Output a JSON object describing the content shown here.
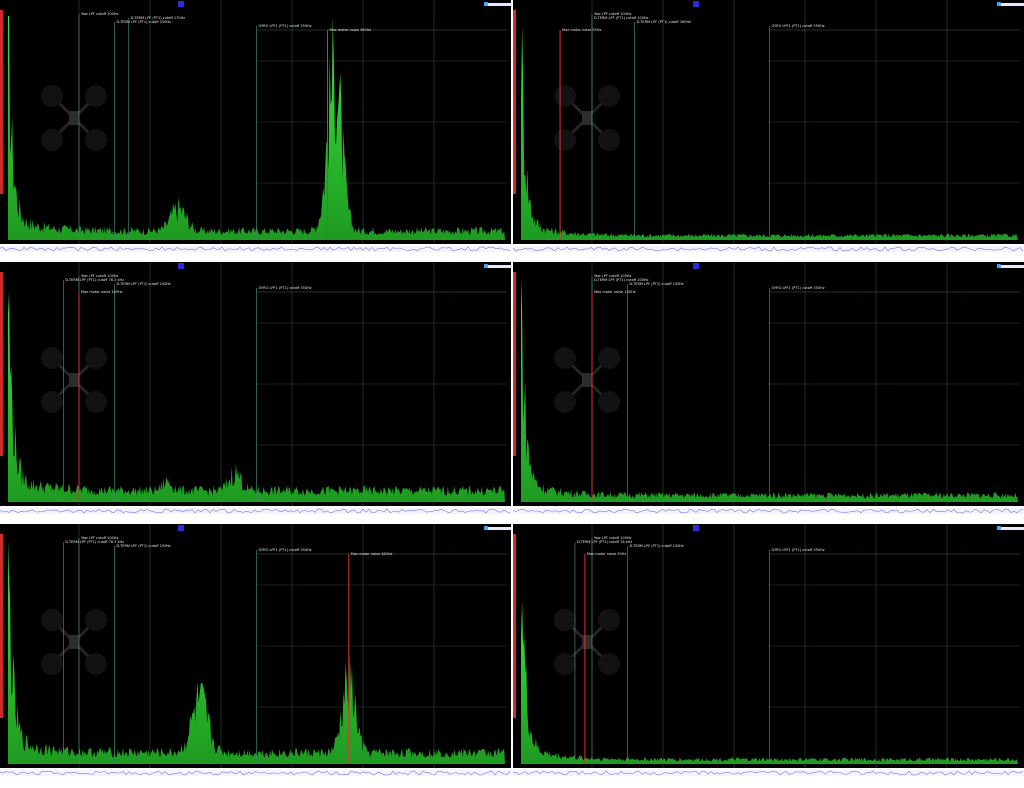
{
  "panels": [
    {
      "id": "p1",
      "title": "",
      "lines": [
        {
          "label": "Yaw LPF cutoff 100Hz",
          "hz": 100
        },
        {
          "label": "D-TERM LPF (PT1) cutoff 170Hz",
          "hz": 170
        },
        {
          "label": "D-TERM LPF (PT1) cutoff 150Hz",
          "hz": 150
        },
        {
          "label": "GYRO LPF1 (PT1) cutoff 350Hz",
          "hz": 350
        },
        {
          "label": "Max motor noise 450Hz",
          "hz": 450
        }
      ],
      "spectrum": {
        "base": 4,
        "peaks": [
          {
            "hz": 240,
            "amp": 10,
            "w": 15
          },
          {
            "hz": 460,
            "amp": 70,
            "w": 14
          }
        ]
      }
    },
    {
      "id": "p2",
      "title": "",
      "lines": [
        {
          "label": "Yaw LPF cutoff 100Hz",
          "hz": 100
        },
        {
          "label": "D-TERM LPF (PT1) cutoff 100Hz",
          "hz": 100
        },
        {
          "label": "D-TERM LPF (PT1) cutoff 160Hz",
          "hz": 160
        },
        {
          "label": "GYRO LPF1 (PT1) cutoff 350Hz",
          "hz": 350
        },
        {
          "label": "Max motor noise 55Hz",
          "hz": 55
        }
      ],
      "spectrum": {
        "base": 2,
        "peaks": []
      }
    },
    {
      "id": "p3",
      "title": "",
      "lines": [
        {
          "label": "Yaw LPF cutoff 100Hz",
          "hz": 100
        },
        {
          "label": "D-TERM LPF (PT1) cutoff 78.3 kHz",
          "hz": 78
        },
        {
          "label": "D-TERM LPF (PT1) cutoff 150Hz",
          "hz": 150
        },
        {
          "label": "GYRO LPF1 (PT1) cutoff 350Hz",
          "hz": 350
        },
        {
          "label": "Max motor noise 100Hz",
          "hz": 100
        }
      ],
      "spectrum": {
        "base": 5,
        "peaks": [
          {
            "hz": 225,
            "amp": 4,
            "w": 10
          },
          {
            "hz": 320,
            "amp": 8,
            "w": 12
          }
        ]
      }
    },
    {
      "id": "p4",
      "title": "",
      "lines": [
        {
          "label": "Yaw LPF cutoff 100Hz",
          "hz": 100
        },
        {
          "label": "D-TERM LPF (PT1) cutoff 100Hz",
          "hz": 100
        },
        {
          "label": "D-TERM LPF (PT1) cutoff 150Hz",
          "hz": 150
        },
        {
          "label": "GYRO LPF1 (PT1) cutoff 350Hz",
          "hz": 350
        },
        {
          "label": "Max motor noise 100Hz",
          "hz": 100
        }
      ],
      "spectrum": {
        "base": 3,
        "peaks": []
      }
    },
    {
      "id": "p5",
      "title": "",
      "lines": [
        {
          "label": "Yaw LPF cutoff 100Hz",
          "hz": 100
        },
        {
          "label": "D-TERM LPF (PT1) cutoff 78.3 kHz",
          "hz": 78
        },
        {
          "label": "D-TERM LPF (PT1) cutoff 150Hz",
          "hz": 150
        },
        {
          "label": "GYRO LPF1 (PT1) cutoff 350Hz",
          "hz": 350
        },
        {
          "label": "Max motor noise 480Hz",
          "hz": 480
        }
      ],
      "spectrum": {
        "base": 5,
        "peaks": [
          {
            "hz": 270,
            "amp": 22,
            "w": 16
          },
          {
            "hz": 480,
            "amp": 30,
            "w": 13
          }
        ]
      }
    },
    {
      "id": "p6",
      "title": "",
      "lines": [
        {
          "label": "Yaw LPF cutoff 100Hz",
          "hz": 100
        },
        {
          "label": "D-TERM LPF (PT1) cutoff 76 kHz",
          "hz": 76
        },
        {
          "label": "D-TERM LPF (PT1) cutoff 150Hz",
          "hz": 150
        },
        {
          "label": "GYRO LPF1 (PT1) cutoff 350Hz",
          "hz": 350
        },
        {
          "label": "Max motor noise 90Hz",
          "hz": 90
        }
      ],
      "spectrum": {
        "base": 2,
        "peaks": []
      }
    }
  ],
  "chart_data": [
    {
      "type": "area",
      "title": "",
      "xlabel": "",
      "ylabel": "",
      "xlim": [
        0,
        700
      ],
      "ylim": [
        0,
        100
      ],
      "grid": true
    },
    {
      "type": "area",
      "title": "",
      "xlabel": "",
      "ylabel": "",
      "xlim": [
        0,
        700
      ],
      "ylim": [
        0,
        100
      ],
      "grid": true
    },
    {
      "type": "area",
      "title": "",
      "xlabel": "",
      "ylabel": "",
      "xlim": [
        0,
        700
      ],
      "ylim": [
        0,
        100
      ],
      "grid": true
    },
    {
      "type": "area",
      "title": "",
      "xlabel": "",
      "ylabel": "",
      "xlim": [
        0,
        700
      ],
      "ylim": [
        0,
        100
      ],
      "grid": true
    },
    {
      "type": "area",
      "title": "",
      "xlabel": "",
      "ylabel": "",
      "xlim": [
        0,
        700
      ],
      "ylim": [
        0,
        100
      ],
      "grid": true
    },
    {
      "type": "area",
      "title": "",
      "xlabel": "",
      "ylabel": "",
      "xlim": [
        0,
        700
      ],
      "ylim": [
        0,
        100
      ],
      "grid": true
    }
  ],
  "colors": {
    "spectrum": "#39e83a",
    "spectrum_dark": "#1f9a22",
    "cutoff_line": "#e53030",
    "grid": "#2d4a3a",
    "title_bg": "#2b2bd8",
    "strip_line": "#7777ee"
  }
}
